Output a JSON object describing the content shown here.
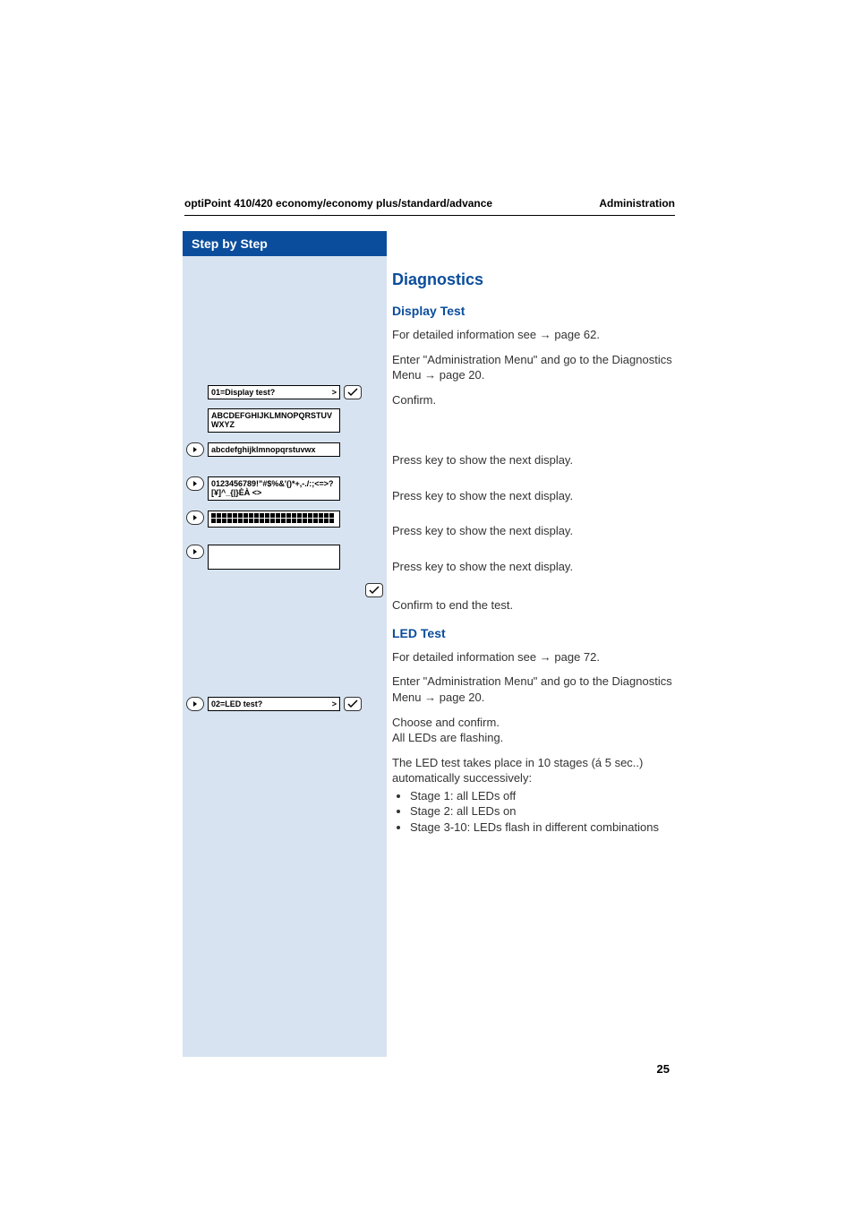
{
  "header": {
    "left": "optiPoint 410/420 economy/economy plus/standard/advance",
    "right": "Administration"
  },
  "sidebar": {
    "title": "Step by Step"
  },
  "main": {
    "title": "Diagnostics",
    "display_test": {
      "heading": "Display Test",
      "line1_a": "For detailed information see ",
      "line1_b": " page 62.",
      "line2_a": "Enter \"Administration Menu\" and go to the Diagnostics Menu ",
      "line2_b": " page 20.",
      "confirm": "Confirm.",
      "press1": "Press key to show the next display.",
      "press2": "Press key to show the next display.",
      "press3": "Press key to show the next display.",
      "press4": "Press key to show the next display.",
      "confirm_end": "Confirm to end the test."
    },
    "led_test": {
      "heading": "LED Test",
      "line1_a": "For detailed information see ",
      "line1_b": " page 72.",
      "line2_a": "Enter \"Administration Menu\" and go to the Diagnostics Menu ",
      "line2_b": " page 20.",
      "choose": "Choose and confirm.",
      "flashing": "All LEDs are flashing.",
      "desc": "The LED test takes place in 10 stages (á 5 sec..) automatically successively:",
      "b1": "Stage 1: all LEDs off",
      "b2": "Stage 2: all LEDs on",
      "b3": "Stage 3-10: LEDs flash in different combinations"
    }
  },
  "steps": {
    "s1_label": "01=Display test?",
    "s1_gt": ">",
    "s2_label": "ABCDEFGHIJKLMNOPQRSTUVWXYZ",
    "s3_label": "abcdefghijklmnopqrstuvwx",
    "s4_label": "0123456789!\"#$%&'()*+,-./:;<=>?[¥]^_{|}ÈÀ <>",
    "s7_label": "02=LED test?",
    "s7_gt": ">"
  },
  "page_number": "25"
}
